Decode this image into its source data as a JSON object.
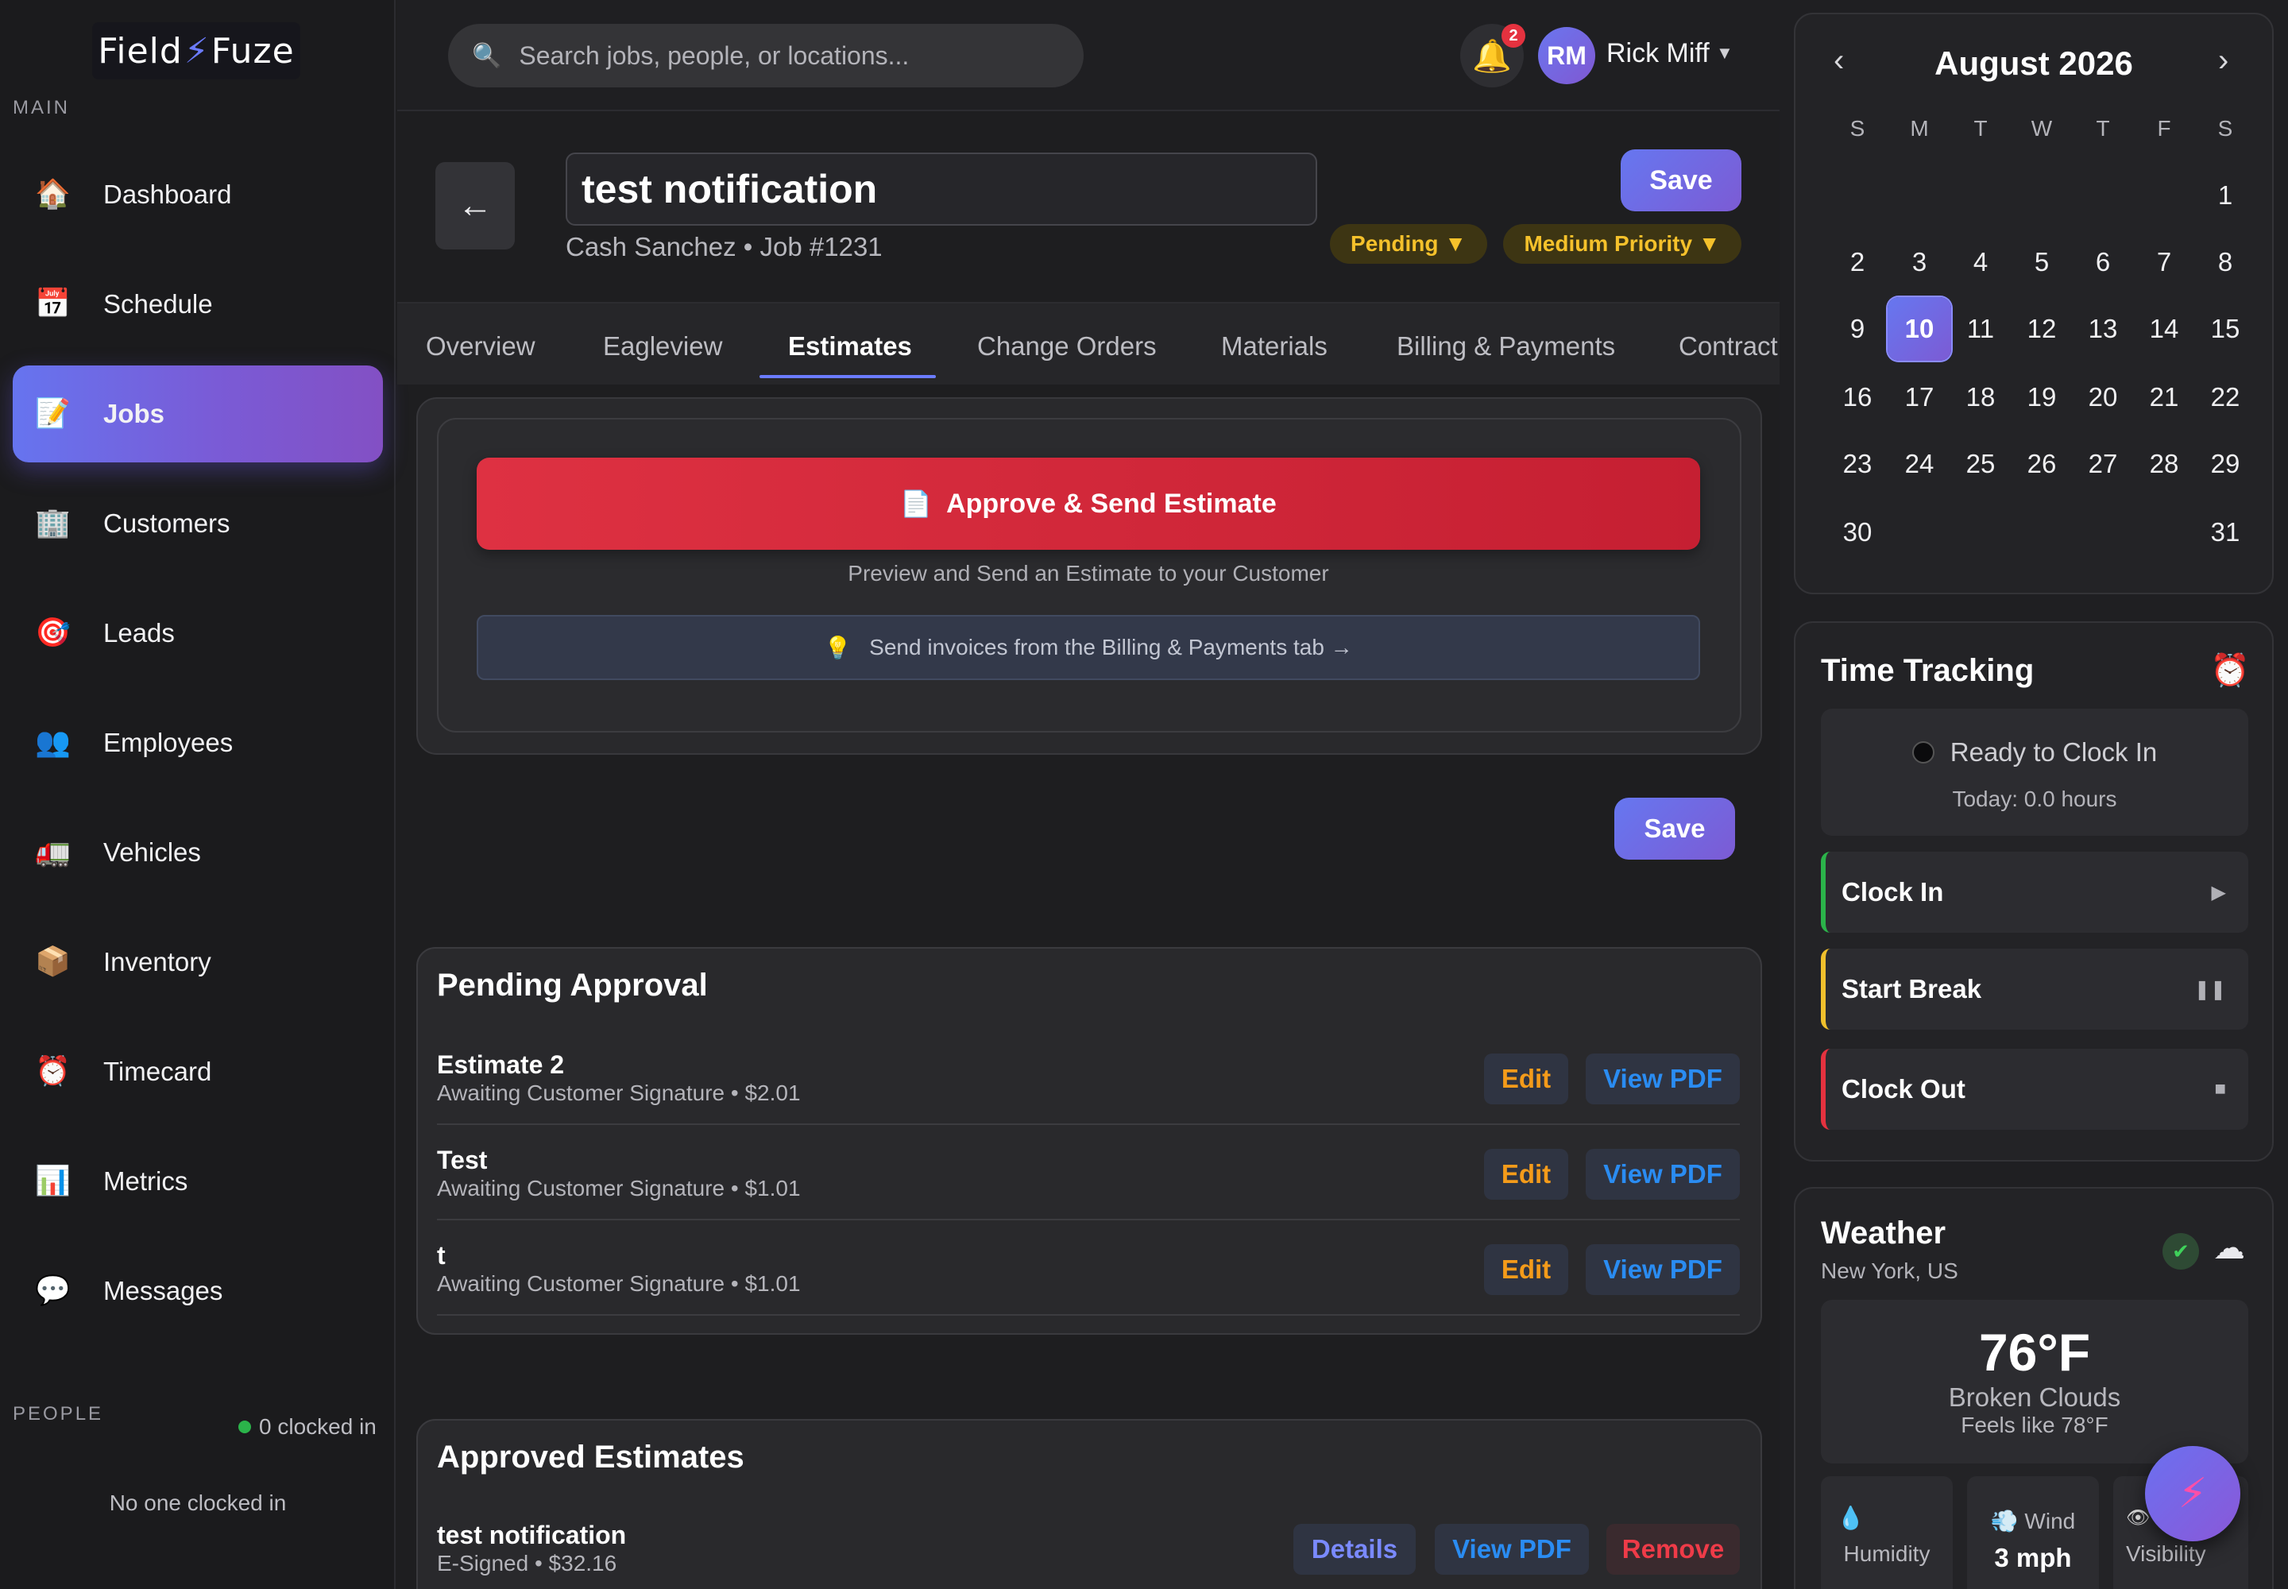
{
  "brand": {
    "logo_text_left": "Field",
    "logo_text_right": "Fuze"
  },
  "sidebar": {
    "main_label": "MAIN",
    "items": [
      {
        "label": "Dashboard",
        "icon": "house-icon"
      },
      {
        "label": "Schedule",
        "icon": "calendar-icon"
      },
      {
        "label": "Jobs",
        "icon": "memo-icon",
        "active": true
      },
      {
        "label": "Customers",
        "icon": "office-building-icon"
      },
      {
        "label": "Leads",
        "icon": "target-icon"
      },
      {
        "label": "Employees",
        "icon": "people-icon"
      },
      {
        "label": "Vehicles",
        "icon": "truck-icon"
      },
      {
        "label": "Inventory",
        "icon": "package-icon"
      },
      {
        "label": "Timecard",
        "icon": "alarm-clock-icon"
      },
      {
        "label": "Metrics",
        "icon": "bar-chart-icon"
      },
      {
        "label": "Messages",
        "icon": "speech-bubble-icon"
      }
    ],
    "people_label": "PEOPLE",
    "clocked_in": "0 clocked in",
    "no_one": "No one clocked in"
  },
  "topbar": {
    "search_placeholder": "Search jobs, people, or locations...",
    "notification_count": "2",
    "user_initials": "RM",
    "user_name": "Rick Miff"
  },
  "job": {
    "title": "test notification",
    "customer": "Cash Sanchez",
    "job_number": "Job #1231",
    "subtitle": "Cash Sanchez • Job #1231",
    "save_label": "Save",
    "status": "Pending ▼",
    "priority": "Medium Priority ▼"
  },
  "tabs": [
    "Overview",
    "Eagleview",
    "Estimates",
    "Change Orders",
    "Materials",
    "Billing & Payments",
    "Contract"
  ],
  "active_tab": "Estimates",
  "estimates": {
    "approve_button": "Approve & Send Estimate",
    "approve_sub": "Preview and Send an Estimate to your Customer",
    "tip": "Send invoices from the Billing & Payments tab →",
    "save_label": "Save",
    "pending": {
      "title": "Pending Approval",
      "rows": [
        {
          "name": "Estimate 2",
          "sub": "Awaiting Customer Signature • $2.01",
          "edit": "Edit",
          "pdf": "View PDF"
        },
        {
          "name": "Test",
          "sub": "Awaiting Customer Signature • $1.01",
          "edit": "Edit",
          "pdf": "View PDF"
        },
        {
          "name": "t",
          "sub": "Awaiting Customer Signature • $1.01",
          "edit": "Edit",
          "pdf": "View PDF"
        }
      ]
    },
    "approved": {
      "title": "Approved Estimates",
      "rows": [
        {
          "name": "test notification",
          "sub": "E-Signed • $32.16",
          "details": "Details",
          "pdf": "View PDF",
          "remove": "Remove"
        }
      ]
    }
  },
  "calendar": {
    "month": "August 2026",
    "prev": "‹",
    "next": "›",
    "dow": [
      "S",
      "M",
      "T",
      "W",
      "T",
      "F",
      "S"
    ],
    "weeks": [
      [
        "",
        "",
        "",
        "",
        "",
        "",
        "1"
      ],
      [
        "2",
        "3",
        "4",
        "5",
        "6",
        "7",
        "8"
      ],
      [
        "9",
        "10",
        "11",
        "12",
        "13",
        "14",
        "15"
      ],
      [
        "16",
        "17",
        "18",
        "19",
        "20",
        "21",
        "22"
      ],
      [
        "23",
        "24",
        "25",
        "26",
        "27",
        "28",
        "29"
      ],
      [
        "30",
        "",
        "",
        "",
        "",
        "",
        "31"
      ]
    ],
    "today": "10"
  },
  "time_tracking": {
    "title": "Time Tracking",
    "status": "Ready to Clock In",
    "today": "Today: 0.0 hours",
    "clock_in": "Clock In",
    "start_break": "Start Break",
    "clock_out": "Clock Out"
  },
  "weather": {
    "title": "Weather",
    "location": "New York, US",
    "temp": "76°F",
    "condition": "Broken Clouds",
    "feels_like": "Feels like 78°F",
    "humidity_label": "Humidity",
    "wind_label": "Wind",
    "wind_value": "3 mph",
    "visibility_label": "Visibility"
  },
  "colors": {
    "accent": "#6b7cff",
    "danger": "#de3142",
    "warning": "#f5c12b",
    "edit": "#f49b1a",
    "link": "#2a8cf2"
  }
}
